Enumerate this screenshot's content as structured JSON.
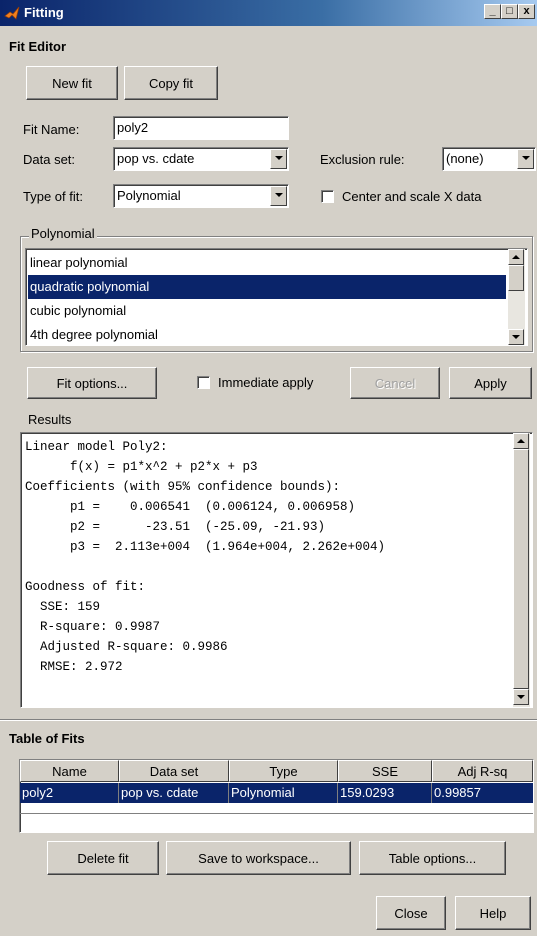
{
  "window": {
    "title": "Fitting",
    "controls": [
      "_",
      "□",
      "x"
    ]
  },
  "fit_editor": {
    "section_title": "Fit Editor",
    "new_fit": "New fit",
    "copy_fit": "Copy fit",
    "fit_name_label": "Fit Name:",
    "fit_name_value": "poly2",
    "data_set_label": "Data set:",
    "data_set_value": "pop vs. cdate",
    "exclusion_label": "Exclusion rule:",
    "exclusion_value": "(none)",
    "type_label": "Type of fit:",
    "type_value": "Polynomial",
    "center_scale_label": "Center and scale X data",
    "center_scale_checked": false
  },
  "polynomial": {
    "group_title": "Polynomial",
    "items": [
      "linear polynomial",
      "quadratic polynomial",
      "cubic polynomial",
      "4th degree polynomial"
    ],
    "selected_index": 1
  },
  "actions": {
    "fit_options": "Fit options...",
    "immediate_apply": "Immediate apply",
    "immediate_apply_checked": false,
    "cancel": "Cancel",
    "apply": "Apply"
  },
  "results": {
    "label": "Results",
    "text": "Linear model Poly2:\n      f(x) = p1*x^2 + p2*x + p3\nCoefficients (with 95% confidence bounds):\n      p1 =    0.006541  (0.006124, 0.006958)\n      p2 =      -23.51  (-25.09, -21.93)\n      p3 =  2.113e+004  (1.964e+004, 2.262e+004)\n\nGoodness of fit:\n  SSE: 159\n  R-square: 0.9987\n  Adjusted R-square: 0.9986\n  RMSE: 2.972"
  },
  "table_of_fits": {
    "section_title": "Table of Fits",
    "columns": [
      "Name",
      "Data set",
      "Type",
      "SSE",
      "Adj R-sq"
    ],
    "rows": [
      [
        "poly2",
        "pop vs. cdate",
        "Polynomial",
        "159.0293",
        "0.99857"
      ]
    ],
    "delete_fit": "Delete fit",
    "save_to_workspace": "Save to workspace...",
    "table_options": "Table options..."
  },
  "footer": {
    "close": "Close",
    "help": "Help"
  },
  "colors": {
    "selection": "#0a246a",
    "face": "#d4d0c8"
  }
}
